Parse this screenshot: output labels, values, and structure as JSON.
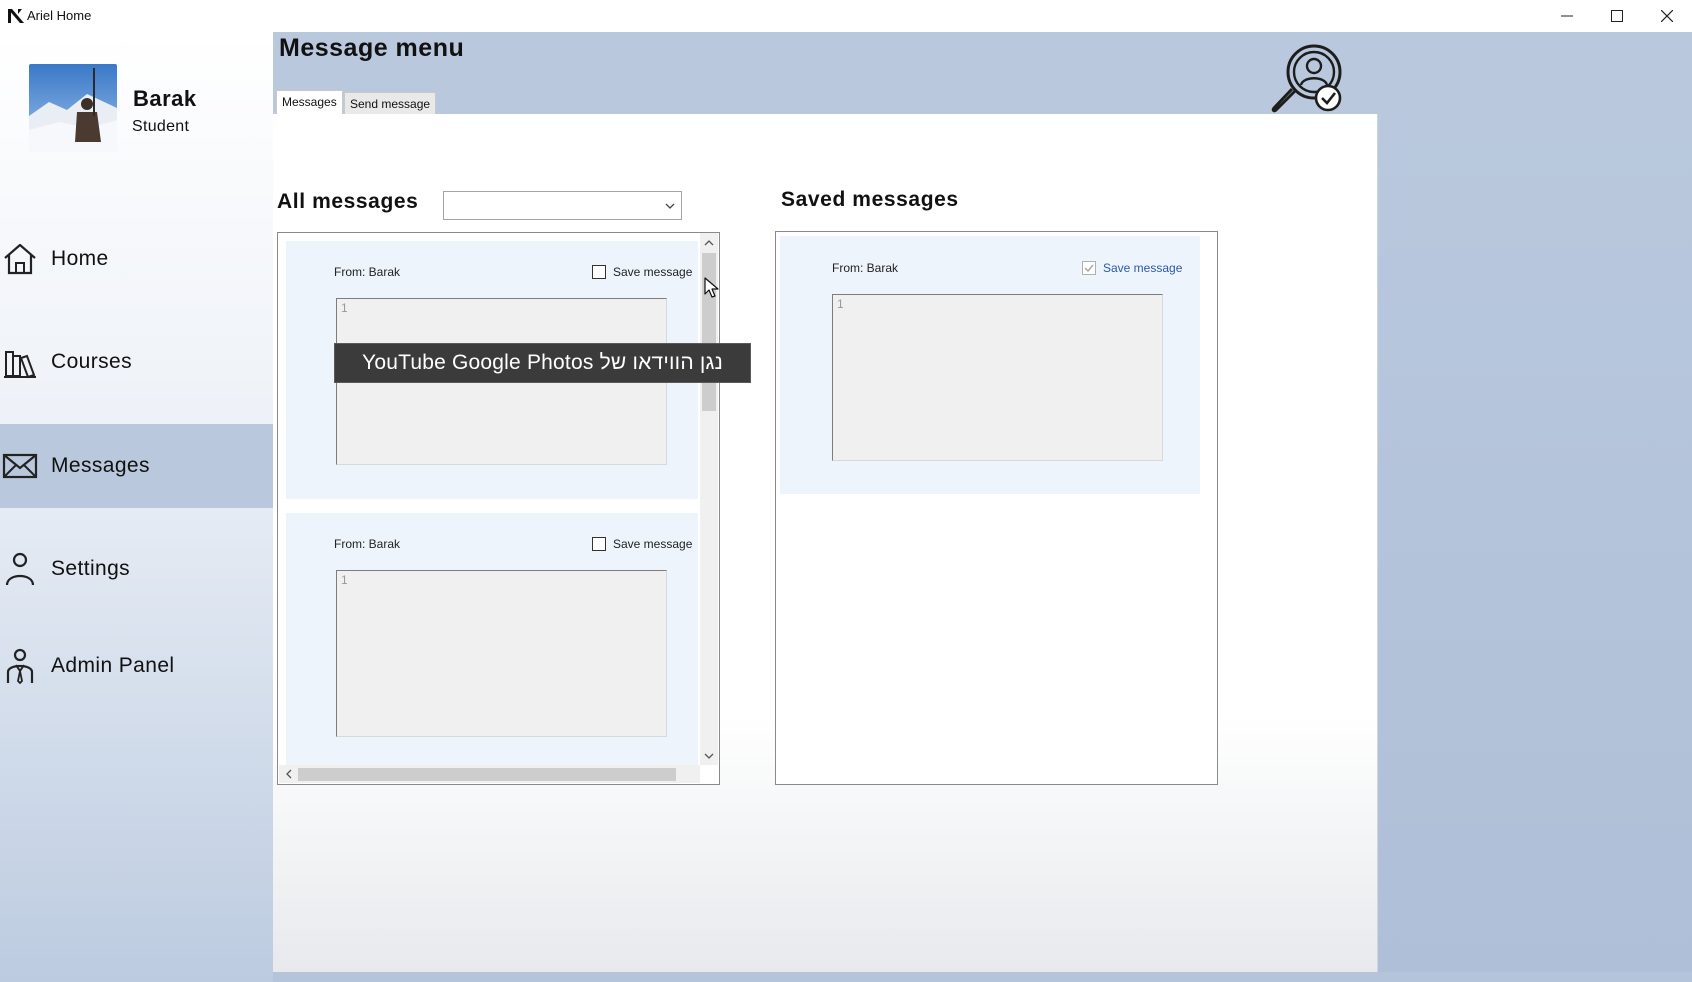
{
  "window": {
    "title": "Ariel Home",
    "controls": [
      "minimize",
      "maximize",
      "close"
    ]
  },
  "user": {
    "name": "Barak",
    "role": "Student"
  },
  "sidebar": {
    "items": [
      {
        "label": "Home",
        "icon": "home-icon",
        "active": false
      },
      {
        "label": "Courses",
        "icon": "courses-icon",
        "active": false
      },
      {
        "label": "Messages",
        "icon": "envelope-icon",
        "active": true
      },
      {
        "label": "Settings",
        "icon": "person-icon",
        "active": false
      },
      {
        "label": "Admin Panel",
        "icon": "admin-icon",
        "active": false
      }
    ]
  },
  "header": {
    "title": "Message menu"
  },
  "tabs": [
    {
      "label": "Messages",
      "selected": true
    },
    {
      "label": "Send message",
      "selected": false
    }
  ],
  "all_messages": {
    "title": "All messages",
    "filter_value": "",
    "items": [
      {
        "from": "From: Barak",
        "save_label": "Save message",
        "saved": false,
        "text": "1"
      },
      {
        "from": "From: Barak",
        "save_label": "Save message",
        "saved": false,
        "text": "1"
      }
    ]
  },
  "saved_messages": {
    "title": "Saved messages",
    "items": [
      {
        "from": "From: Barak",
        "save_label": "Save message",
        "saved": true,
        "text": "1"
      }
    ]
  },
  "tooltip": {
    "text": "נגן הווידאו של YouTube Google Photos"
  },
  "colors": {
    "accent": "#b9c8dd",
    "active_nav": "#b9c8dd",
    "card": "#eef4fb",
    "checked_label": "#2a5aa8"
  }
}
